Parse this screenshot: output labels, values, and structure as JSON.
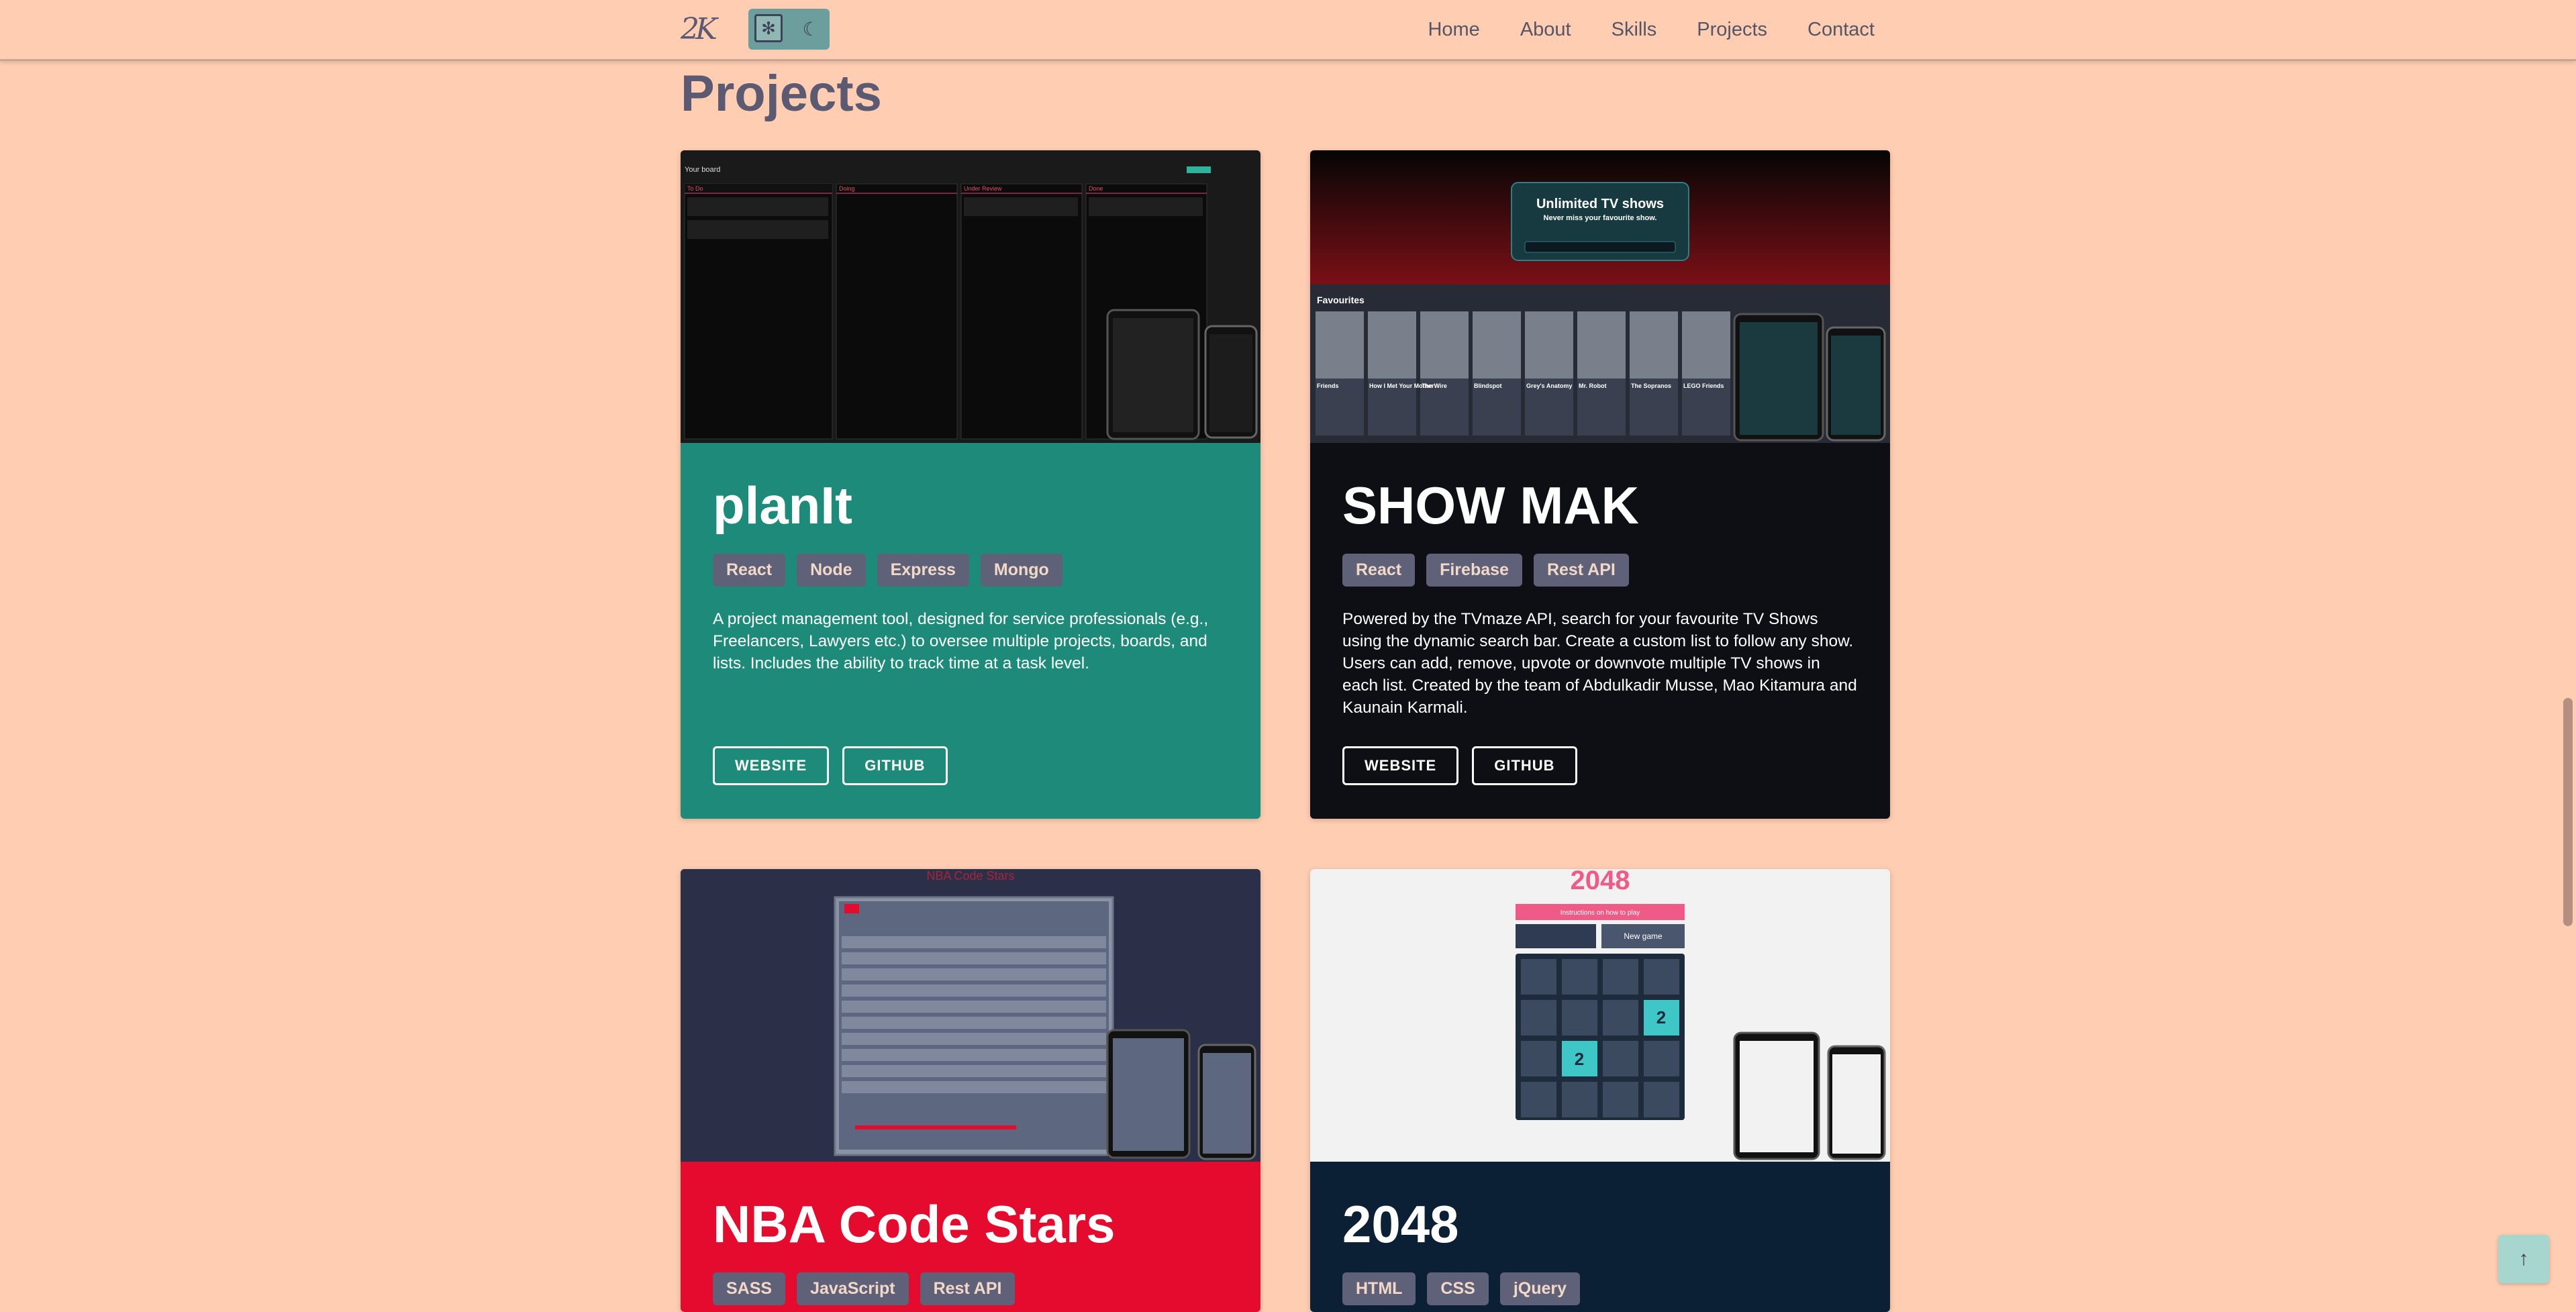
{
  "nav": {
    "logo": "2K",
    "links": [
      "Home",
      "About",
      "Skills",
      "Projects",
      "Contact"
    ]
  },
  "section_title": "Projects",
  "projects": [
    {
      "title": "planIt",
      "tags": [
        "React",
        "Node",
        "Express",
        "Mongo"
      ],
      "description": "A project management tool, designed for service professionals (e.g., Freelancers, Lawyers etc.) to oversee multiple projects, boards, and lists. Includes the ability to track time at a task level.",
      "buttons": [
        "WEBSITE",
        "GITHUB"
      ],
      "color": "#1e8a7a",
      "preview": {
        "app_title": "Your board",
        "columns": [
          "To Do",
          "Doing",
          "Under Review",
          "Done"
        ]
      }
    },
    {
      "title": "SHOW MAK",
      "tags": [
        "React",
        "Firebase",
        "Rest API"
      ],
      "description": "Powered by the TVmaze API, search for your favourite TV Shows using the dynamic search bar. Create a custom list to follow any show. Users can add, remove, upvote or downvote multiple TV shows in each list. Created by the team of Abdulkadir Musse, Mao Kitamura and Kaunain Karmali.",
      "buttons": [
        "WEBSITE",
        "GITHUB"
      ],
      "color": "#0e0f14",
      "preview": {
        "hero": "Unlimited TV shows",
        "hero_sub": "Never miss your favourite show.",
        "list_title": "Favourites",
        "shows": [
          "Friends",
          "How I Met Your Mother",
          "The Wire",
          "Blindspot",
          "Grey's Anatomy",
          "Mr. Robot",
          "The Sopranos",
          "LEGO Friends"
        ]
      }
    },
    {
      "title": "NBA Code Stars",
      "tags": [
        "SASS",
        "JavaScript",
        "Rest API"
      ],
      "color": "#e40b2e",
      "preview": {
        "heading": "NBA Code Stars"
      }
    },
    {
      "title": "2048",
      "tags": [
        "HTML",
        "CSS",
        "jQuery"
      ],
      "color": "#0b2035",
      "preview": {
        "game_title": "2048",
        "instructions": "Instructions on how to play",
        "new_game": "New game",
        "tiles": [
          "2",
          "2"
        ]
      }
    }
  ]
}
